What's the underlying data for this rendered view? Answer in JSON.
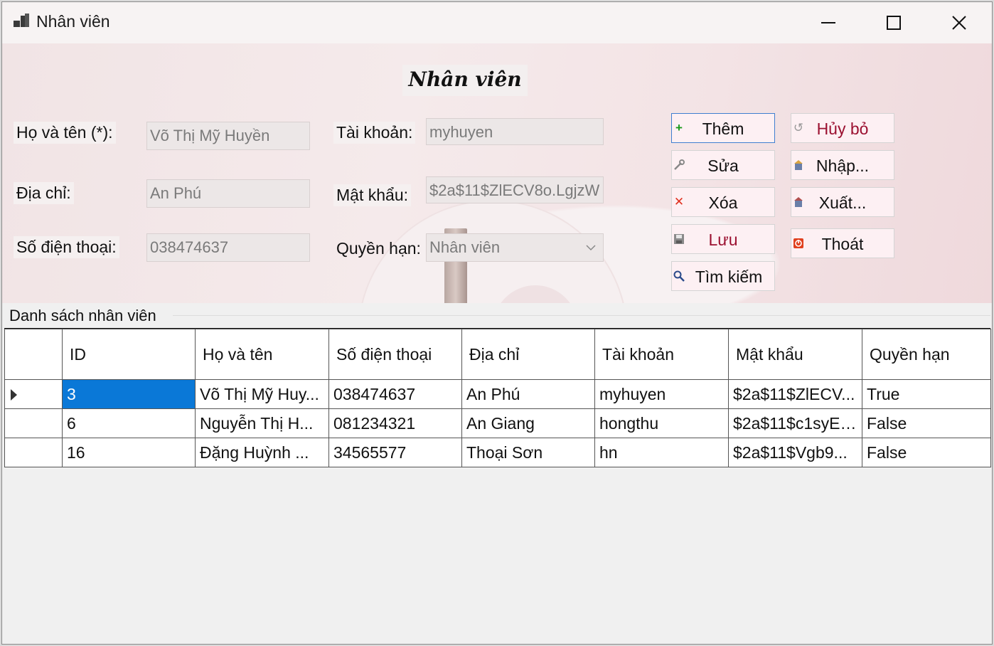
{
  "window": {
    "title": "Nhân viên"
  },
  "form": {
    "heading": "Nhân viên",
    "labels": {
      "fullname": "Họ và tên (*):",
      "address": "Địa chỉ:",
      "phone": "Số điện thoại:",
      "account": "Tài khoản:",
      "password": "Mật khẩu:",
      "role": "Quyền hạn:"
    },
    "values": {
      "fullname": "Võ Thị Mỹ Huyền",
      "address": "An Phú",
      "phone": "038474637",
      "account": "myhuyen",
      "password": "$2a$11$ZlECV8o.LgjzW",
      "role": "Nhân viên"
    }
  },
  "buttons": {
    "add": "Thêm",
    "edit": "Sửa",
    "delete": "Xóa",
    "save": "Lưu",
    "search": "Tìm kiếm",
    "cancel": "Hủy bỏ",
    "import": "Nhập...",
    "export": "Xuất...",
    "exit": "Thoát"
  },
  "list": {
    "group_title": "Danh sách nhân viên",
    "columns": [
      "ID",
      "Họ và tên",
      "Số điện thoại",
      "Địa chỉ",
      "Tài khoản",
      "Mật khẩu",
      "Quyền hạn"
    ],
    "rows": [
      [
        "3",
        "Võ Thị Mỹ Huy...",
        "038474637",
        "An Phú",
        "myhuyen",
        "$2a$11$ZlECV...",
        "True"
      ],
      [
        "6",
        "Nguyễn Thị H...",
        "081234321",
        "An Giang",
        "hongthu",
        "$2a$11$c1syEt...",
        "False"
      ],
      [
        "16",
        "Đặng Huỳnh ...",
        "34565577",
        "Thoại Sơn",
        "hn",
        "$2a$11$Vgb9...",
        "False"
      ]
    ],
    "selected_row": 0
  }
}
